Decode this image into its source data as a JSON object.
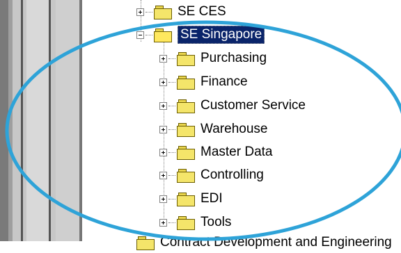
{
  "tree": {
    "top_item": "SE CES",
    "selected_item": "SE Singapore",
    "children": [
      {
        "label": "Purchasing"
      },
      {
        "label": "Finance"
      },
      {
        "label": "Customer Service"
      },
      {
        "label": "Warehouse"
      },
      {
        "label": "Master Data"
      },
      {
        "label": "Controlling"
      },
      {
        "label": "EDI"
      },
      {
        "label": "Tools"
      }
    ],
    "partial_bottom_item": "Contract Development and Engineering"
  },
  "colors": {
    "selection": "#0a246a",
    "highlight_ellipse": "#2ea3d8",
    "folder": "#f4e56a"
  },
  "icons": {
    "folder": "folder-icon",
    "expander": "plus-expander-icon"
  }
}
